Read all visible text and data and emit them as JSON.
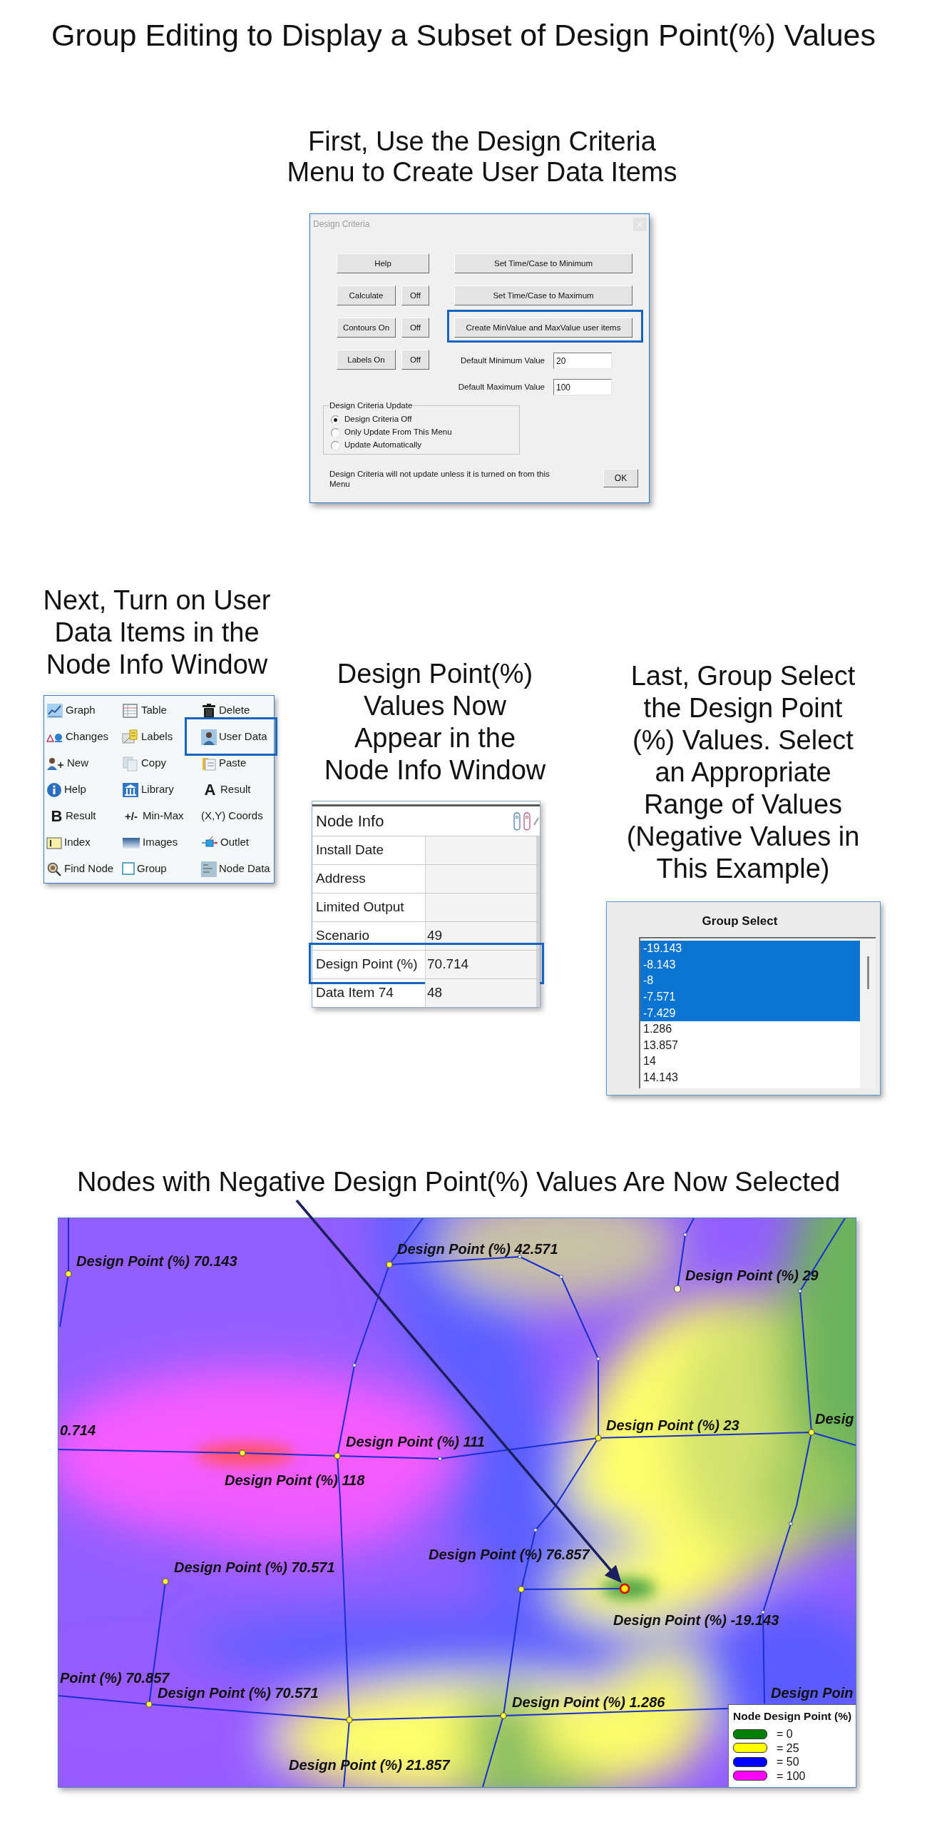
{
  "title": "Group Editing to Display a Subset of Design Point(%) Values",
  "step_1": {
    "heading": [
      "First, Use the Design Criteria",
      "Menu to Create User Data Items"
    ],
    "dialog": {
      "title": "Design Criteria",
      "left_buttons": [
        {
          "label": "Help"
        },
        {
          "label": "Calculate",
          "toggle": "Off"
        },
        {
          "label": "Contours On",
          "toggle": "Off"
        },
        {
          "label": "Labels On",
          "toggle": "Off"
        }
      ],
      "right_buttons": [
        {
          "label": "Set Time/Case to Minimum",
          "highlighted": false
        },
        {
          "label": "Set Time/Case to Maximum",
          "highlighted": false
        },
        {
          "label": "Create MinValue and MaxValue user items",
          "highlighted": true
        }
      ],
      "fields": [
        {
          "label": "Default Minimum Value",
          "value": "20"
        },
        {
          "label": "Default Maximum Value",
          "value": "100"
        }
      ],
      "update_group": {
        "legend": "Design Criteria Update",
        "options": [
          {
            "label": "Design Criteria Off",
            "selected": true
          },
          {
            "label": "Only Update From This Menu",
            "selected": false
          },
          {
            "label": "Update Automatically",
            "selected": false
          }
        ]
      },
      "note": "Design Criteria will not update unless it is turned on from this Menu",
      "ok_button": "OK"
    }
  },
  "step_2": {
    "heading": [
      "Next, Turn on User",
      "Data Items in the",
      "Node Info Window"
    ],
    "toolbar": {
      "items": [
        {
          "label": "Graph",
          "highlighted": false
        },
        {
          "label": "Table",
          "highlighted": false
        },
        {
          "label": "Delete",
          "highlighted": false
        },
        {
          "label": "Changes",
          "highlighted": false
        },
        {
          "label": "Labels",
          "highlighted": false
        },
        {
          "label": "User Data",
          "highlighted": true
        },
        {
          "label": "New",
          "highlighted": false
        },
        {
          "label": "Copy",
          "highlighted": false
        },
        {
          "label": "Paste",
          "highlighted": false
        },
        {
          "label": "Help",
          "highlighted": false
        },
        {
          "label": "Library",
          "highlighted": false
        },
        {
          "label": "Result",
          "glyph": "A",
          "highlighted": false
        },
        {
          "label": "Result",
          "glyph": "B",
          "highlighted": false
        },
        {
          "label": "Min-Max",
          "glyph": "+/-",
          "highlighted": false
        },
        {
          "label": "(X,Y) Coords",
          "highlighted": false
        },
        {
          "label": "Index",
          "highlighted": false
        },
        {
          "label": "Images",
          "highlighted": false
        },
        {
          "label": "Outlet",
          "highlighted": false
        },
        {
          "label": "Find Node",
          "highlighted": false
        },
        {
          "label": "Group",
          "highlighted": false
        },
        {
          "label": "Node Data",
          "highlighted": false
        }
      ]
    }
  },
  "step_3": {
    "heading": [
      "Design Point(%)",
      "Values Now",
      "Appear in the",
      "Node Info Window"
    ],
    "window": {
      "title": "Node Info",
      "rows": [
        {
          "label": "Install Date",
          "highlighted": false
        },
        {
          "label": "Address",
          "highlighted": false
        },
        {
          "label": "Limited Output",
          "highlighted": false
        },
        {
          "label": "Scenario",
          "value": "49",
          "highlighted": false
        },
        {
          "label": "Design Point (%)",
          "value": "70.714",
          "highlighted": true
        },
        {
          "label": "Data Item 74",
          "value": "48",
          "highlighted": false
        }
      ]
    }
  },
  "step_4": {
    "heading": [
      "Last, Group Select",
      "the Design Point",
      "(%) Values. Select",
      "an Appropriate",
      "Range of Values",
      "(Negative Values in",
      "This Example)"
    ],
    "panel": {
      "title": "Group Select",
      "items": [
        {
          "value": "-19.143",
          "selected": true
        },
        {
          "value": "-8.143",
          "selected": true
        },
        {
          "value": "-8",
          "selected": true
        },
        {
          "value": "-7.571",
          "selected": true
        },
        {
          "value": "-7.429",
          "selected": true
        },
        {
          "value": "1.286",
          "selected": false
        },
        {
          "value": "13.857",
          "selected": false
        },
        {
          "value": "14",
          "selected": false
        },
        {
          "value": "14.143",
          "selected": false
        }
      ]
    }
  },
  "step_5": {
    "heading": "Nodes with Negative Design Point(%) Values Are Now Selected",
    "map": {
      "nodes": [
        {
          "label": "Design Point (%) 70.143",
          "selected": false
        },
        {
          "label": "Design Point (%) 42.571",
          "selected": false
        },
        {
          "label": "Design Point (%) 29",
          "selected": false
        },
        {
          "label": "Design Point (%) 111",
          "selected": false
        },
        {
          "label": "Design Point (%) 23",
          "selected": false
        },
        {
          "label": "Desig",
          "selected": false
        },
        {
          "label": "Design Point (%) 118",
          "selected": false
        },
        {
          "label": "Design Point (%) 70.571",
          "selected": false
        },
        {
          "label": "Design Point (%) 76.857",
          "selected": false
        },
        {
          "label": "Design Point (%) -19.143",
          "selected": true
        },
        {
          "label": "Design Point (%) 70.571",
          "selected": false
        },
        {
          "label": "Design Point (%) 1.286",
          "selected": false
        },
        {
          "label": "Design Point (%) 21.857",
          "selected": false
        }
      ],
      "cut_labels": [
        "0.714",
        "Point (%) 70.857",
        "Design Poin"
      ],
      "legend": {
        "title": "Node Design Point (%)",
        "items": [
          {
            "label": "= 0",
            "color": "#008000"
          },
          {
            "label": "= 25",
            "color": "#ffff00"
          },
          {
            "label": "= 50",
            "color": "#0000ff"
          },
          {
            "label": "= 100",
            "color": "#ff00ff"
          }
        ]
      }
    }
  }
}
